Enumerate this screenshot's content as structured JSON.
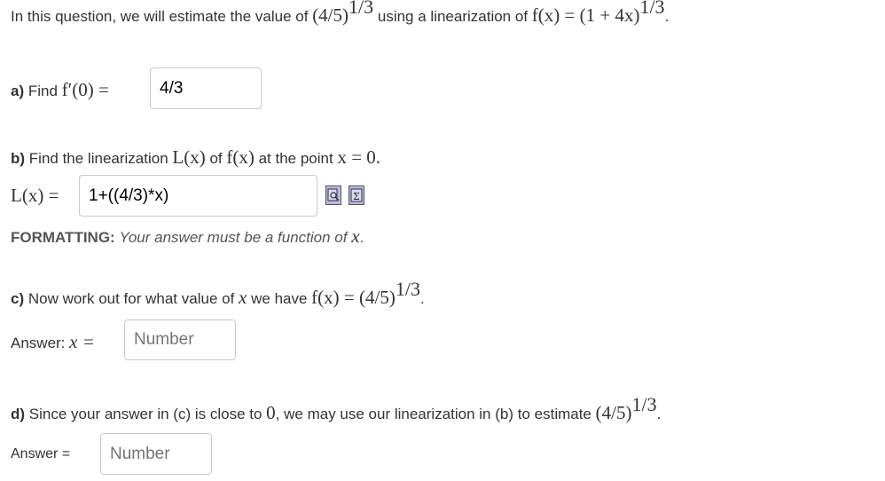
{
  "intro": {
    "text1": "In this question, we will estimate the value of",
    "base": "(4/5)",
    "exp": "1/3",
    "text2": "using a linearization of",
    "func": "f(x) = (1 + 4x)",
    "func_exp": "1/3",
    "end": "."
  },
  "part_a": {
    "label": "a)",
    "text": "Find",
    "expr": "f′(0) =",
    "value": "4/3"
  },
  "part_b": {
    "label": "b)",
    "text1": "Find the linearization",
    "L": "L(x)",
    "text2": "of",
    "f": "f(x)",
    "text3": "at the point",
    "point": "x = 0.",
    "lhs": "L(x) =",
    "value": "1+((4/3)*x)",
    "format_label": "FORMATTING:",
    "format_text": "Your answer must be a function of",
    "format_var": "x",
    "format_end": "."
  },
  "part_c": {
    "label": "c)",
    "text1": "Now work out for what value of",
    "var": "x",
    "text2": "we have",
    "expr": "f(x) = (4/5)",
    "exp": "1/3",
    "end": ".",
    "answer_label": "Answer:",
    "answer_var": "x =",
    "placeholder": "Number"
  },
  "part_d": {
    "label": "d)",
    "text1": "Since your answer in (c) is close to",
    "zero": "0",
    "text2": ", we may use our linearization in (b) to estimate",
    "base": "(4/5)",
    "exp": "1/3",
    "end": ".",
    "answer_label": "Answer =",
    "placeholder": "Number"
  },
  "icons": [
    "equation-preview-icon",
    "equation-editor-icon"
  ]
}
